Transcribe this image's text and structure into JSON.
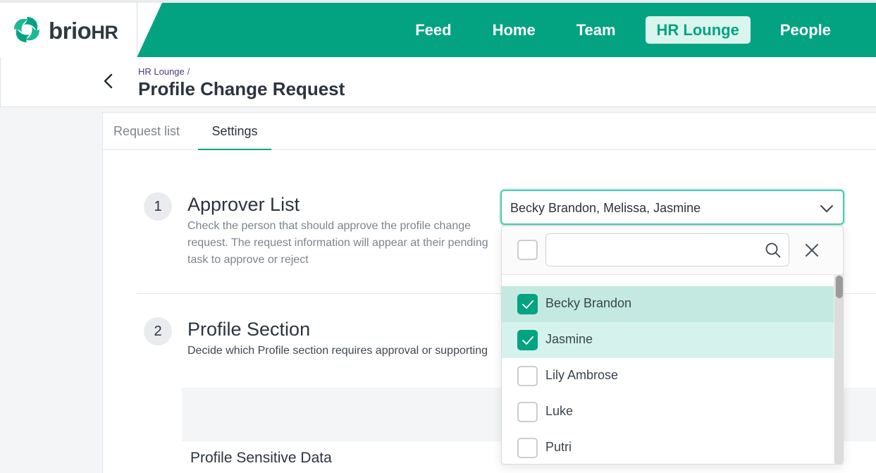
{
  "brand": {
    "name_part1": "brio",
    "name_part2": "HR",
    "accent": "#03a382"
  },
  "nav": {
    "items": [
      {
        "label": "Feed"
      },
      {
        "label": "Home"
      },
      {
        "label": "Team"
      },
      {
        "label": "HR Lounge",
        "active": true
      },
      {
        "label": "People"
      }
    ]
  },
  "header": {
    "breadcrumb": "HR Lounge",
    "breadcrumb_sep": "/",
    "title": "Profile Change Request"
  },
  "tabs": [
    {
      "label": "Request list"
    },
    {
      "label": "Settings",
      "active": true
    }
  ],
  "sections": [
    {
      "number": "1",
      "title": "Approver List",
      "desc": "Check the person that should approve the profile change request. The request information will appear at their pending task to approve or reject"
    },
    {
      "number": "2",
      "title": "Profile Section",
      "desc": "Decide which Profile section requires approval or supporting"
    }
  ],
  "sensitive_label": "Profile Sensitive Data",
  "approver_select": {
    "value": "Becky Brandon, Melissa, Jasmine",
    "search_placeholder": "",
    "options": [
      {
        "label": "Becky Brandon",
        "checked": true
      },
      {
        "label": "Jasmine",
        "checked": true
      },
      {
        "label": "Lily Ambrose",
        "checked": false
      },
      {
        "label": "Luke",
        "checked": false
      },
      {
        "label": "Putri",
        "checked": false
      }
    ]
  }
}
